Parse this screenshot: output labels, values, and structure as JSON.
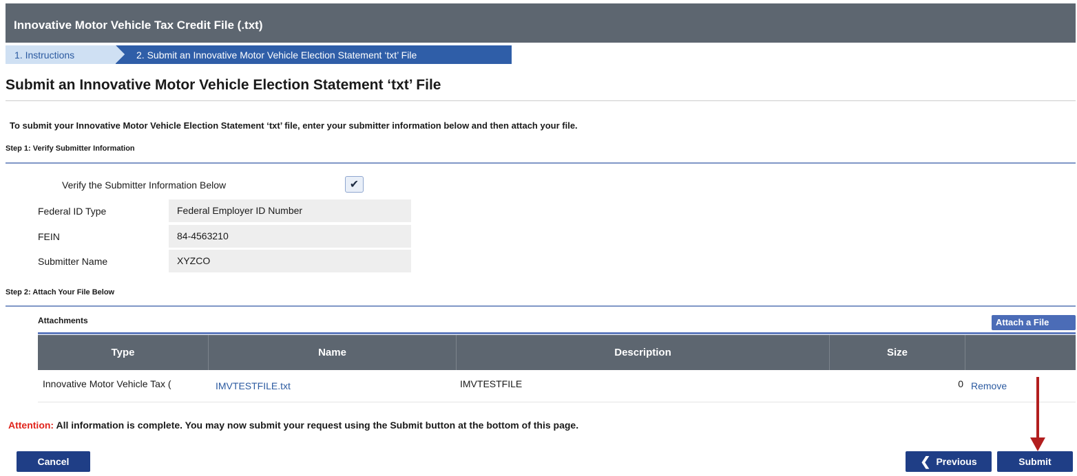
{
  "window_title": "Innovative Motor Vehicle Tax Credit File (.txt)",
  "wizard": {
    "steps": [
      {
        "label": "1. Instructions",
        "state": "completed"
      },
      {
        "label": "2. Submit an Innovative Motor Vehicle Election Statement ‘txt’ File",
        "state": "active"
      }
    ]
  },
  "page_title": "Submit an Innovative Motor Vehicle Election Statement ‘txt’ File",
  "intro_text": "To submit your Innovative Motor Vehicle Election Statement ‘txt’ file, enter your submitter information below and then attach your file.",
  "step1": {
    "heading": "Step 1: Verify Submitter Information",
    "verify_label": "Verify the Submitter Information Below",
    "verify_checked": true,
    "fields": [
      {
        "label": "Federal ID Type",
        "value": "Federal Employer ID Number"
      },
      {
        "label": "FEIN",
        "value": "84-4563210"
      },
      {
        "label": "Submitter Name",
        "value": "XYZCO"
      }
    ]
  },
  "step2": {
    "heading": "Step 2: Attach Your File Below",
    "attachments_title": "Attachments",
    "attach_button": "Attach a File",
    "columns": [
      "Type",
      "Name",
      "Description",
      "Size"
    ],
    "rows": [
      {
        "type": "Innovative Motor Vehicle Tax (",
        "name": "IMVTESTFILE.txt",
        "description": "IMVTESTFILE",
        "size": "0",
        "action": "Remove"
      }
    ]
  },
  "attention": {
    "label": "Attention:",
    "message": " All information is complete. You may now submit your request using the Submit button at the bottom of this page."
  },
  "buttons": {
    "cancel": "Cancel",
    "previous": "Previous",
    "submit": "Submit"
  },
  "colors": {
    "title_bar": "#5d6670",
    "active_step": "#2f5ea8",
    "button": "#1f3e86",
    "attention": "#e0231b",
    "annotation_arrow": "#b21e1e"
  }
}
